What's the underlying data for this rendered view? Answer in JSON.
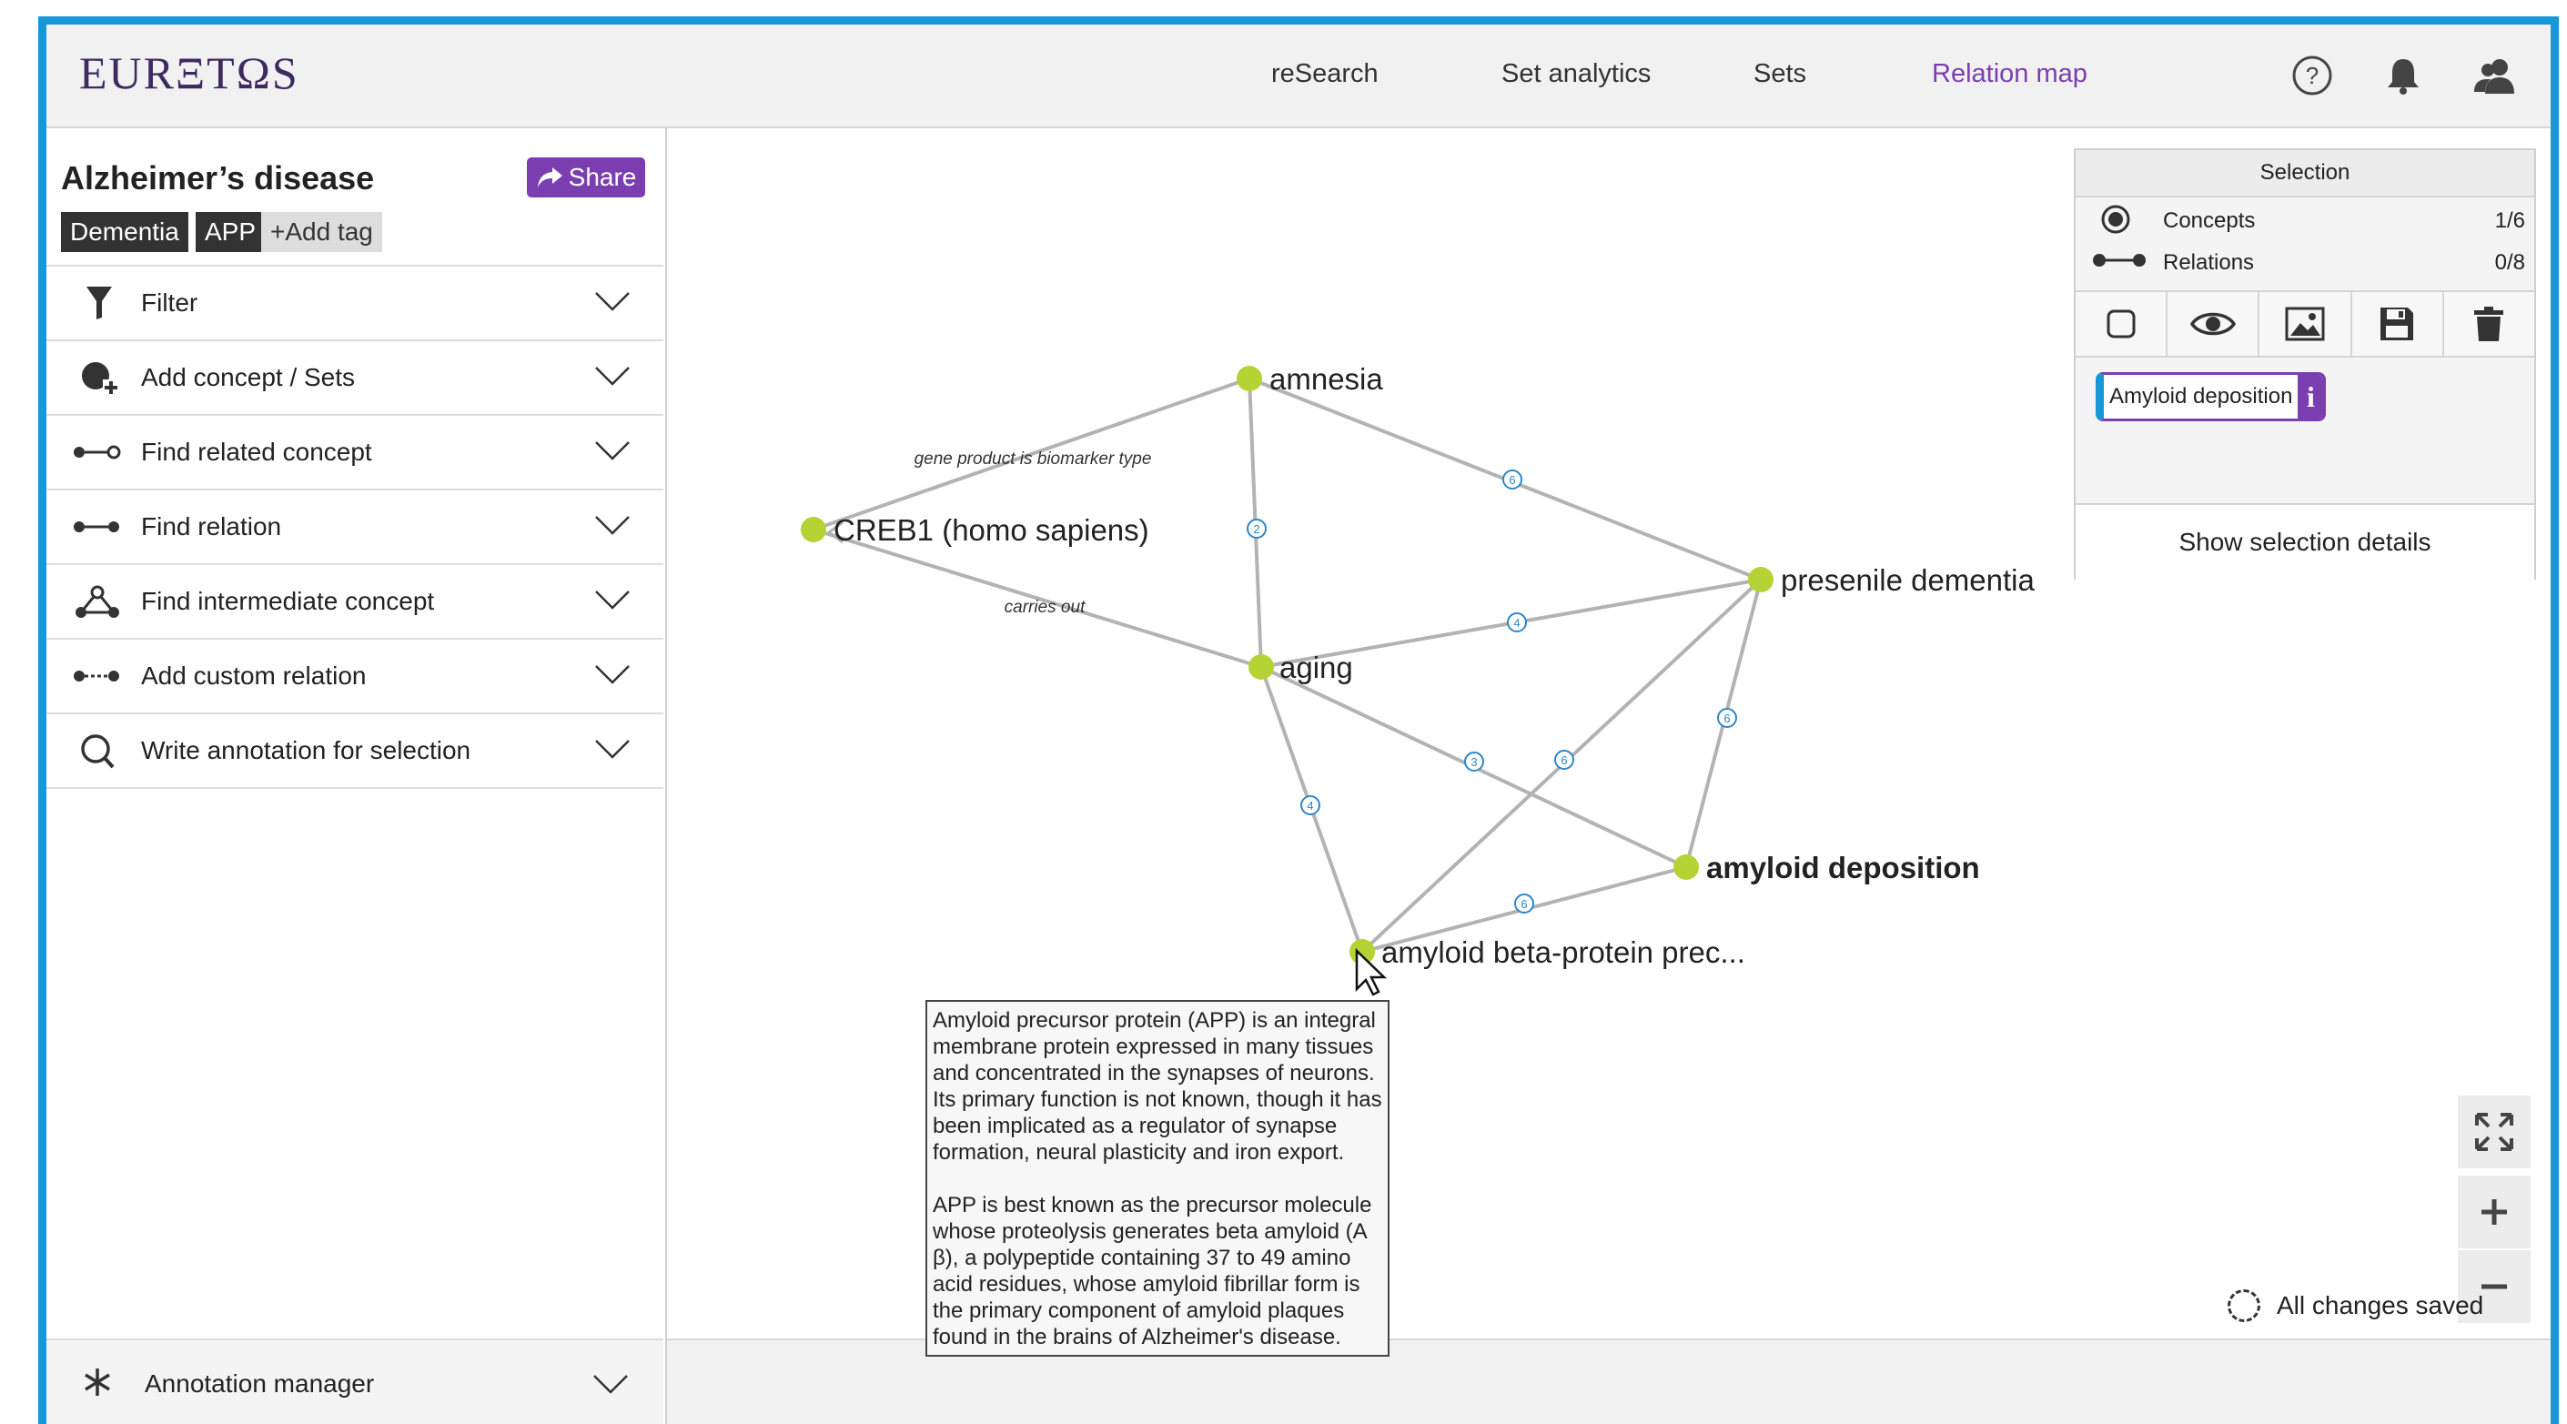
{
  "app": {
    "logo": "EURΞTΩS",
    "nav": [
      "reSearch",
      "Set analytics",
      "Sets",
      "Relation map"
    ],
    "active_nav": "Relation map"
  },
  "sidebar": {
    "project_title": "Alzheimer’s disease",
    "share_label": "Share",
    "tags": [
      "Dementia",
      "APP"
    ],
    "add_tag": "+Add tag",
    "menu": [
      {
        "label": "Filter",
        "icon": "filter-icon"
      },
      {
        "label": "Add concept / Sets",
        "icon": "add-concept-icon"
      },
      {
        "label": "Find related concept",
        "icon": "related-concept-icon"
      },
      {
        "label": "Find relation",
        "icon": "relation-icon"
      },
      {
        "label": "Find intermediate concept",
        "icon": "intermediate-concept-icon"
      },
      {
        "label": "Add custom relation",
        "icon": "custom-relation-icon"
      },
      {
        "label": "Write annotation for selection",
        "icon": "search-icon"
      }
    ],
    "annotation_manager": "Annotation manager"
  },
  "graph": {
    "nodes": {
      "amnesia": "amnesia",
      "creb1": "CREB1 (homo sapiens)",
      "aging": "aging",
      "presenile": "presenile dementia",
      "amyloid_deposition": "amyloid deposition",
      "app": "amyloid beta-protein prec..."
    },
    "edge_labels": {
      "biomarker": "gene product is biomarker type",
      "carries_out": "carries out"
    },
    "edge_counts": {
      "amnesia_aging": "2",
      "amnesia_presenile": "6",
      "aging_presenile": "4",
      "aging_amyloid": "3",
      "app_presenile": "6",
      "presenile_amyloid": "6",
      "aging_app": "4",
      "app_amyloid": "6"
    }
  },
  "selection": {
    "title": "Selection",
    "concepts_label": "Concepts",
    "concepts_count": "1/6",
    "relations_label": "Relations",
    "relations_count": "0/8",
    "chip_label": "Amyloid deposition",
    "chip_info": "i",
    "show_details": "Show selection details"
  },
  "tooltip": {
    "p1": "Amyloid precursor protein (APP) is an integral membrane protein expressed in many tissues and concentrated in the synapses of neurons. Its primary function is not known, though it has been implicated as a regulator of synapse formation, neural plasticity and iron export.",
    "p2": "APP is best known as the precursor molecule whose proteolysis generates beta amyloid (A β), a polypeptide containing 37 to 49 amino acid residues, whose amyloid fibrillar form is the primary component of amyloid plaques found in the brains of Alzheimer's disease."
  },
  "status": {
    "saved": "All changes saved"
  },
  "colors": {
    "accent": "#7a3eb1",
    "frame": "#1597d8",
    "node": "#b5d334",
    "edge": "#b3b3b3",
    "count_badge": "#2e86c9"
  }
}
